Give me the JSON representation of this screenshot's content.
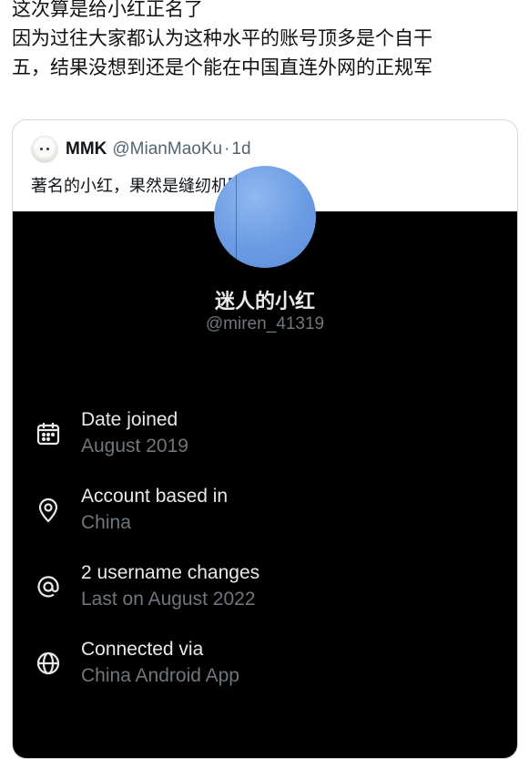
{
  "post": {
    "lines": [
      "这次算是给小红正名了",
      "因为过往大家都认为这种水平的账号顶多是个自干",
      "五，结果没想到还是个能在中国直连外网的正规军"
    ]
  },
  "quote": {
    "author_name": "MMK",
    "author_handle": "@MianMaoKu",
    "separator": "·",
    "time": "1d",
    "text": "著名的小红，果然是缝纫机军"
  },
  "profile": {
    "display_name": "迷人的小红",
    "username": "@miren_41319",
    "details": [
      {
        "icon": "calendar-icon",
        "title": "Date joined",
        "value": "August 2019"
      },
      {
        "icon": "location-pin-icon",
        "title": "Account based in",
        "value": "China"
      },
      {
        "icon": "at-sign-icon",
        "title": "2 username changes",
        "value": "Last on August 2022"
      },
      {
        "icon": "globe-icon",
        "title": "Connected via",
        "value": "China Android App"
      }
    ]
  },
  "colors": {
    "panel_background": "#000000",
    "primary_text_dark": "#e7e9ea",
    "secondary_text_dark": "#71767b",
    "card_border": "#cfd9de",
    "avatar_blue": "#6b9be3"
  }
}
